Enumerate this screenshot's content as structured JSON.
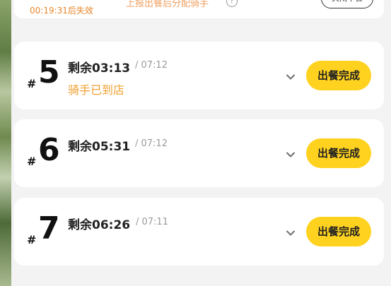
{
  "top_card": {
    "countdown": "00:19:31后失效",
    "notice": "上报出餐后分配骑手",
    "info_icon": "info-icon",
    "close_button": "关闭不餐"
  },
  "orders": [
    {
      "hash": "#",
      "number": "5",
      "remaining": "剩余03:13",
      "deadline": "/ 07:12",
      "status": "骑手已到店",
      "button": "出餐完成"
    },
    {
      "hash": "#",
      "number": "6",
      "remaining": "剩余05:31",
      "deadline": "/ 07:12",
      "status": "",
      "button": "出餐完成"
    },
    {
      "hash": "#",
      "number": "7",
      "remaining": "剩余06:26",
      "deadline": "/ 07:11",
      "status": "",
      "button": "出餐完成"
    }
  ],
  "colors": {
    "accent_yellow": "#ffd21f",
    "status_orange": "#f0a030",
    "countdown_orange": "#e8862a"
  }
}
